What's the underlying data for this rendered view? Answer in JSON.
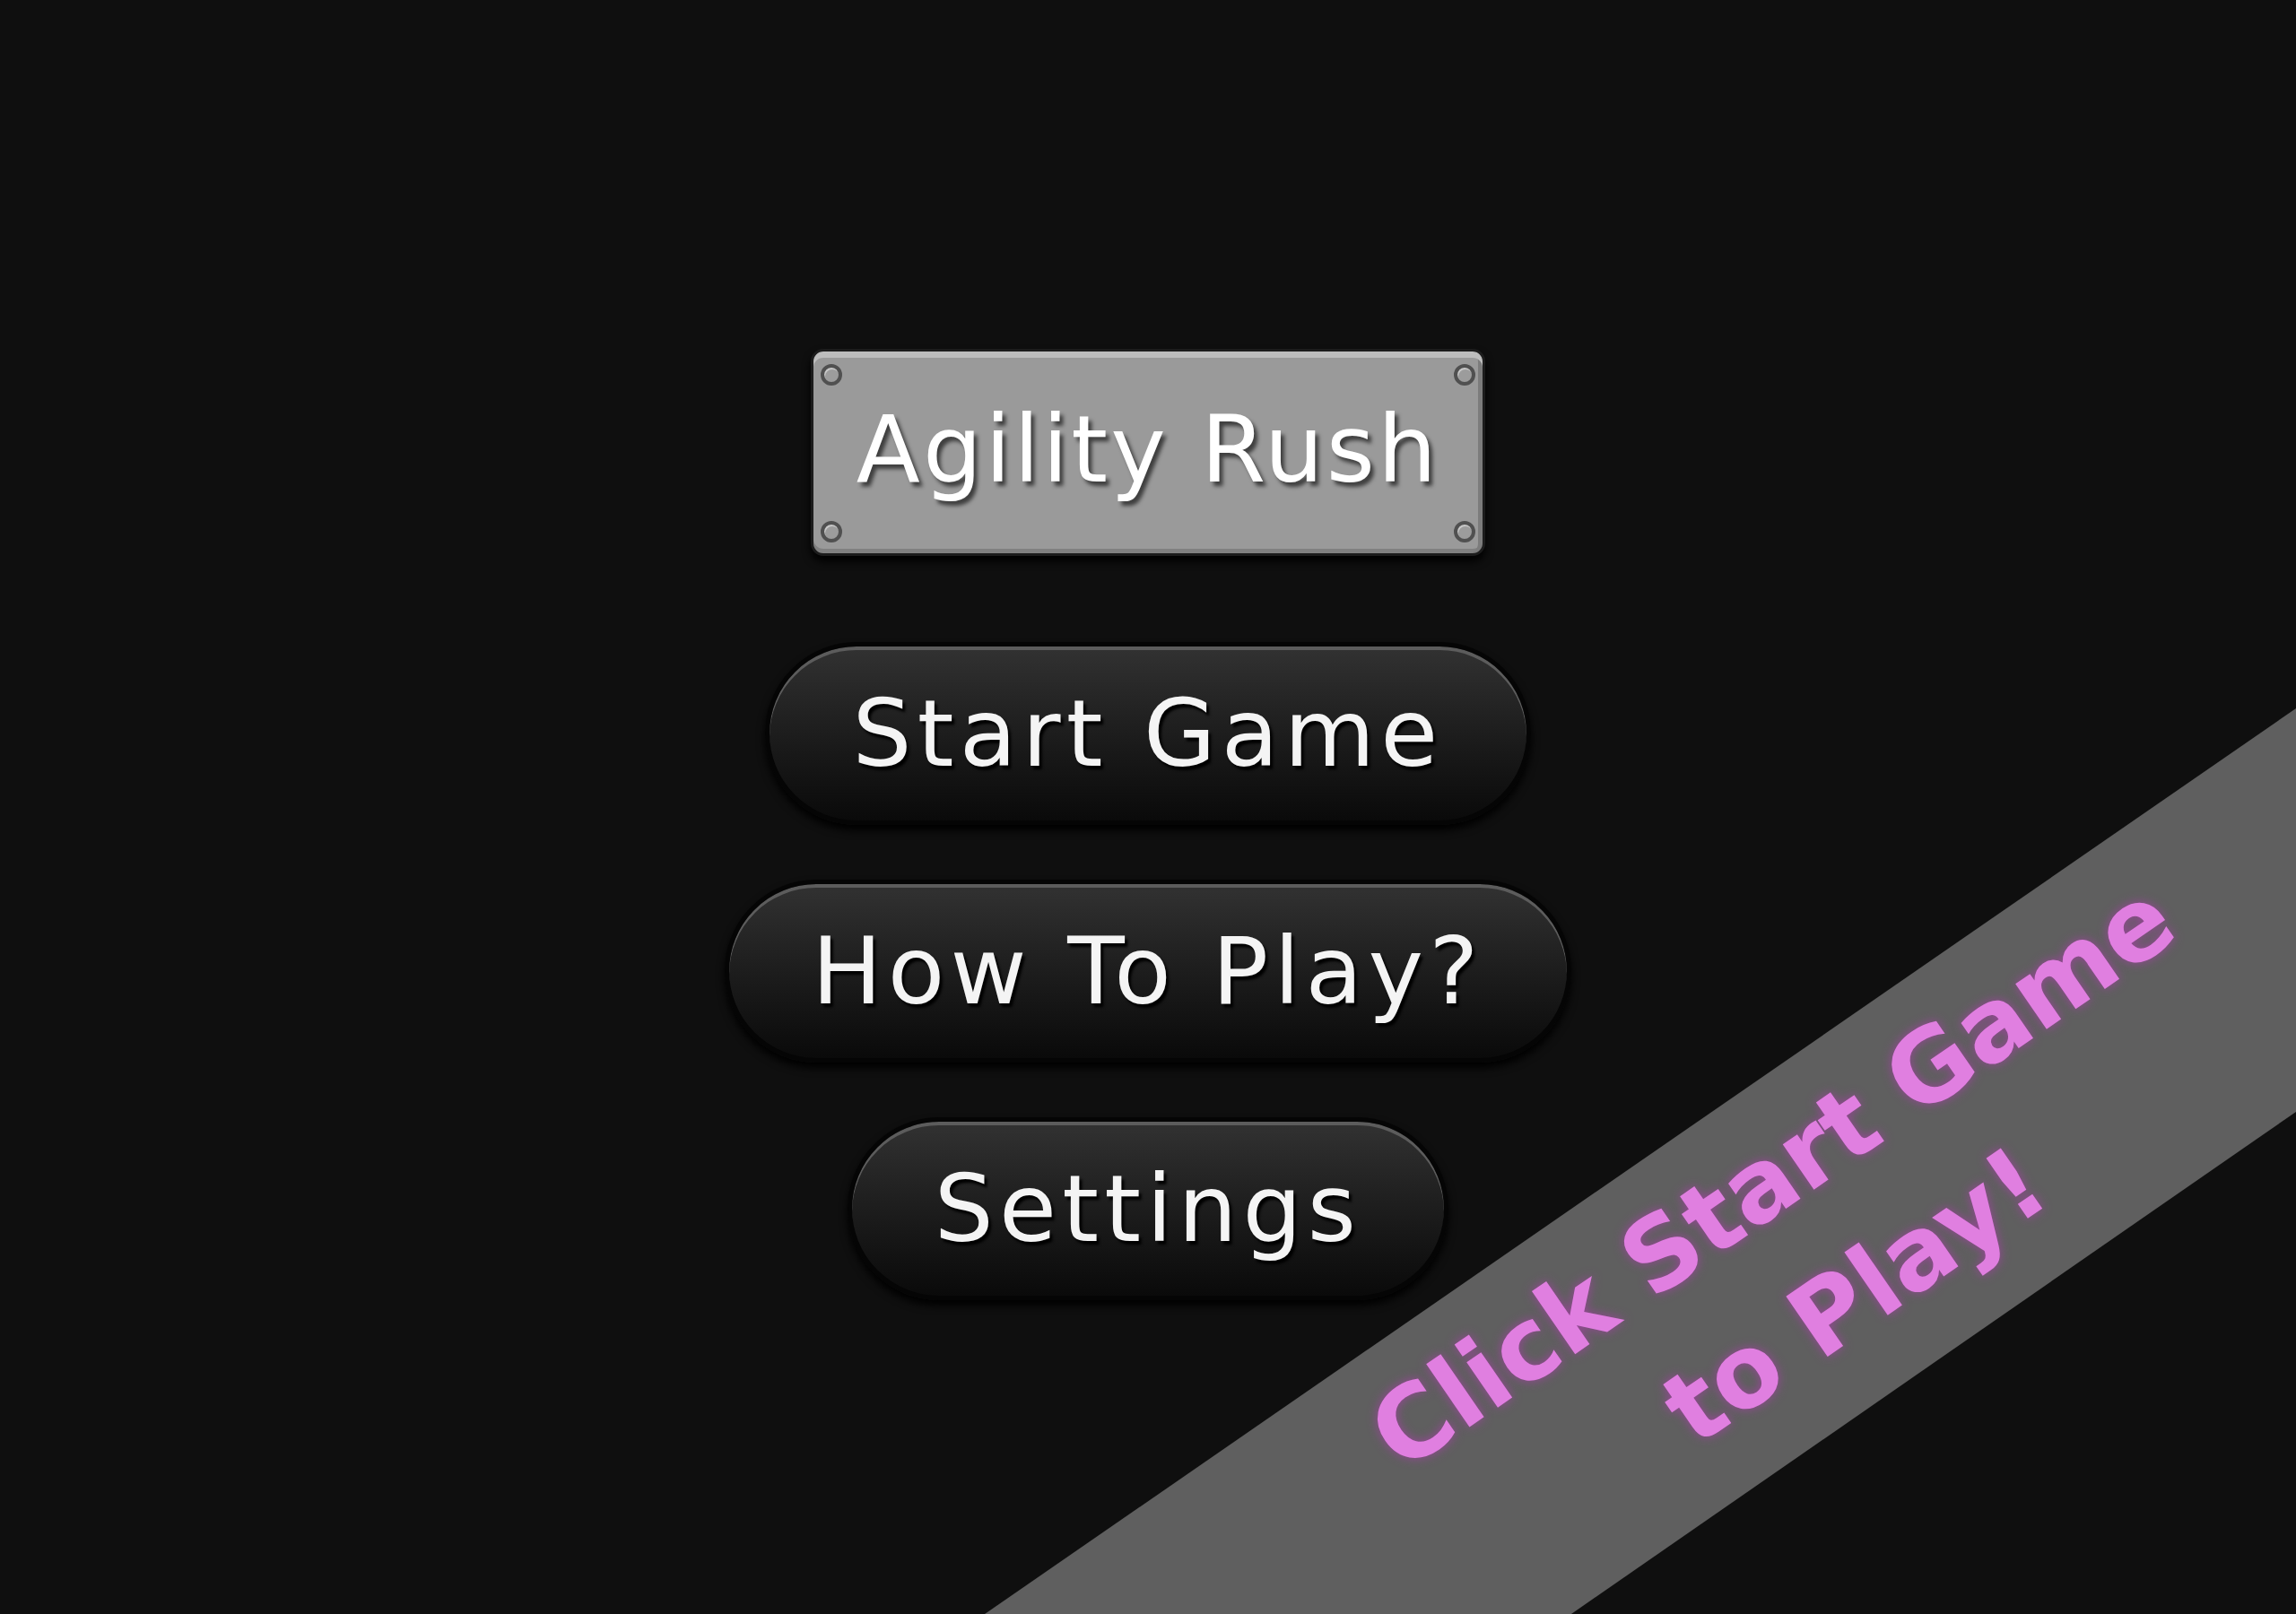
{
  "title": "Agility Rush",
  "menu": [
    {
      "label": "Start Game"
    },
    {
      "label": "How To Play?"
    },
    {
      "label": "Settings"
    }
  ],
  "banner": {
    "text": "Click Start Game to Play!"
  }
}
